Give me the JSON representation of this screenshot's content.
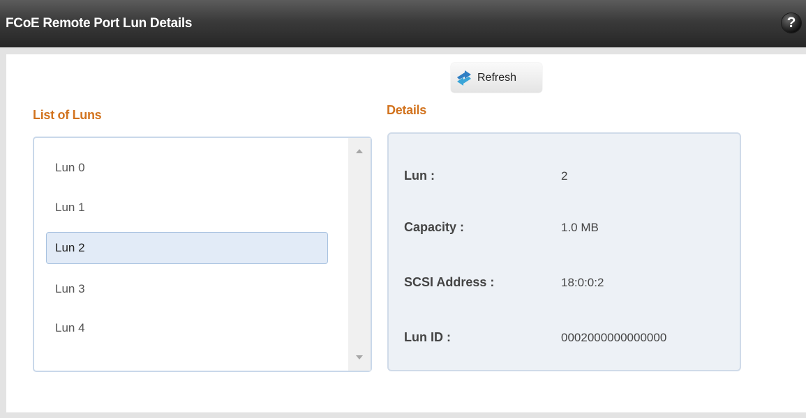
{
  "window": {
    "title": "FCoE Remote Port Lun Details",
    "help_label": "?"
  },
  "toolbar": {
    "refresh_label": "Refresh"
  },
  "list": {
    "title": "List of Luns",
    "items": [
      "Lun 0",
      "Lun 1",
      "Lun 2",
      "Lun 3",
      "Lun 4"
    ],
    "selected": "Lun 2"
  },
  "details": {
    "title": "Details",
    "fields": [
      {
        "label": "Lun :",
        "value": "2"
      },
      {
        "label": "Capacity :",
        "value": "1.0 MB"
      },
      {
        "label": "SCSI Address :",
        "value": "18:0:0:2"
      },
      {
        "label": "Lun ID :",
        "value": "0002000000000000"
      }
    ]
  },
  "colors": {
    "accent": "#d2731e",
    "titlebar": "#333333",
    "selection": "#e2ebf7",
    "details_bg": "#edf1f6"
  },
  "icons": {
    "help": "question-circle-icon",
    "refresh": "refresh-arrows-icon"
  }
}
